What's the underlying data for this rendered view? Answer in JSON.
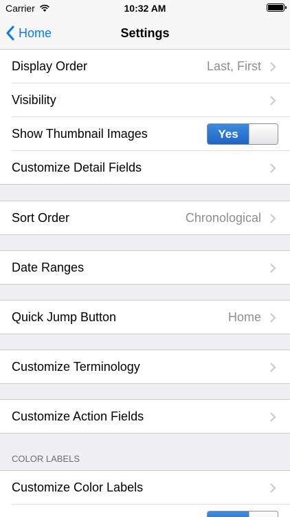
{
  "status_bar": {
    "carrier": "Carrier",
    "time": "10:32 AM"
  },
  "nav": {
    "back_label": "Home",
    "title": "Settings"
  },
  "rows": [
    {
      "label": "Display Order",
      "value": "Last, First"
    },
    {
      "label": "Visibility",
      "value": ""
    },
    {
      "label": "Show Thumbnail Images",
      "toggle": "Yes",
      "on": true
    },
    {
      "label": "Customize Detail Fields",
      "value": ""
    },
    {
      "label": "Sort Order",
      "value": "Chronological"
    },
    {
      "label": "Date Ranges",
      "value": ""
    },
    {
      "label": "Quick Jump Button",
      "value": "Home"
    },
    {
      "label": "Customize Terminology",
      "value": ""
    },
    {
      "label": "Customize Action Fields",
      "value": ""
    },
    {
      "label": "Customize Color Labels",
      "value": ""
    }
  ],
  "sections": {
    "color_labels_header": "COLOR LABELS",
    "partial_toggle": {
      "on": true
    }
  },
  "colors": {
    "accent": "#007aff",
    "background": "#efeff4",
    "toggle_on": "#2a75d6"
  }
}
